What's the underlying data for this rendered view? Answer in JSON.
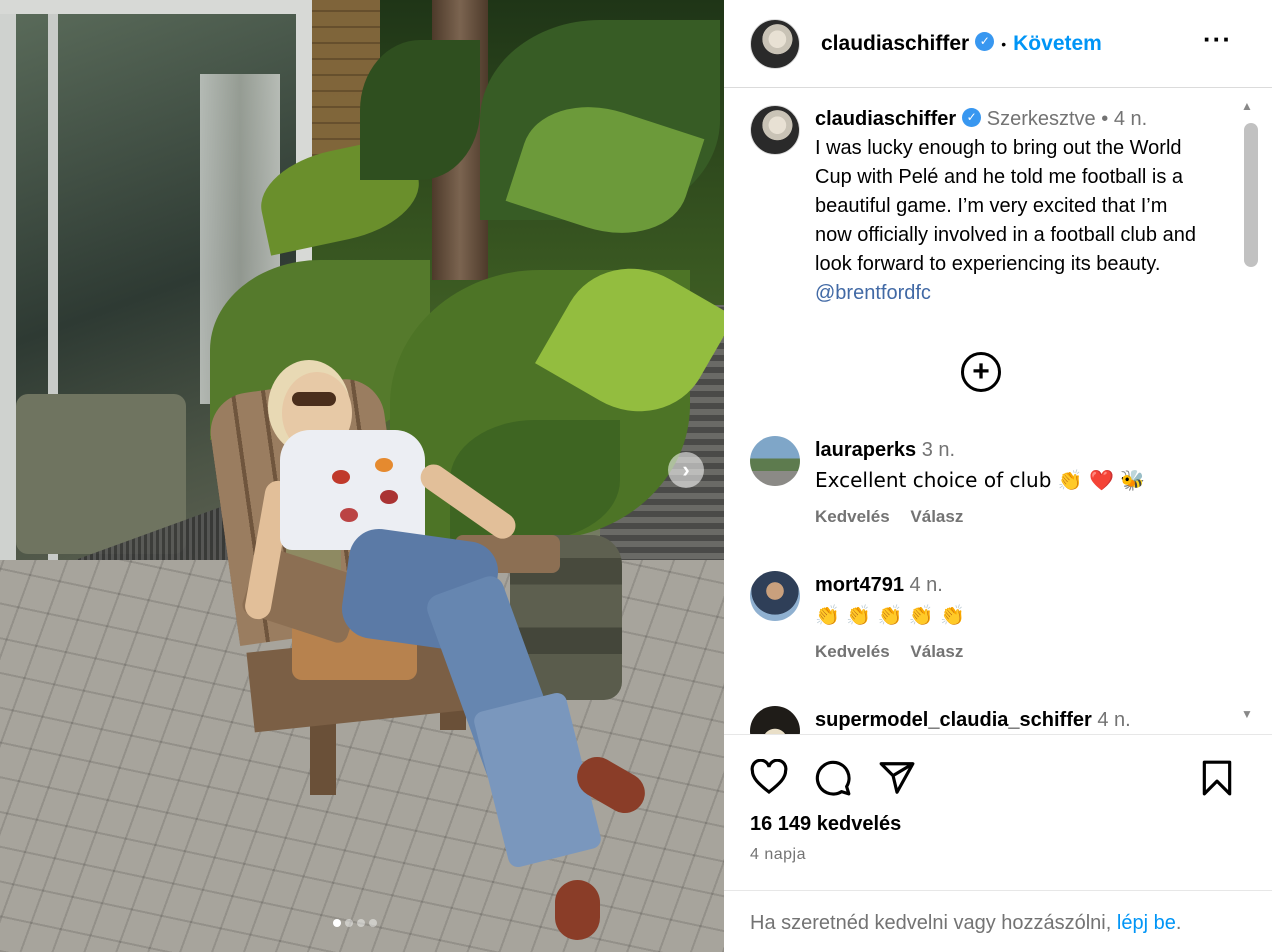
{
  "post": {
    "username": "claudiaschiffer",
    "follow_label": "Követem",
    "separator": "•",
    "more_label": "···"
  },
  "caption": {
    "username": "claudiaschiffer",
    "edited_label": "Szerkesztve",
    "separator": "•",
    "time": "4 n.",
    "text": "I was lucky enough to bring out the World Cup with Pelé and he told me football is a beautiful game. I’m very excited that I’m now officially involved in a football club and look forward to experiencing its beauty.",
    "mention": "@brentfordfc"
  },
  "load_more_icon": "plus-circle-icon",
  "comments": [
    {
      "username": "lauraperks",
      "time": "3 n.",
      "text": "Excellent choice of club 👏 ❤️ 🐝",
      "like_label": "Kedvelés",
      "reply_label": "Válasz"
    },
    {
      "username": "mort4791",
      "time": "4 n.",
      "text": "👏 👏 👏 👏 👏",
      "like_label": "Kedvelés",
      "reply_label": "Válasz"
    },
    {
      "username": "supermodel_claudia_schiffer",
      "time": "4 n."
    }
  ],
  "stats": {
    "likes": "16 149 kedvelés",
    "date": "4 napja"
  },
  "login": {
    "prefix": "Ha szeretnéd kedvelni vagy hozzászólni,",
    "link": "lépj be",
    "suffix": "."
  },
  "carousel": {
    "slide_count": 4,
    "active_index": 0,
    "next_icon": "chevron-right-icon"
  },
  "colors": {
    "accent": "#0095f6",
    "verified": "#3897f0",
    "muted": "#737373",
    "heart": "#ed4956"
  }
}
